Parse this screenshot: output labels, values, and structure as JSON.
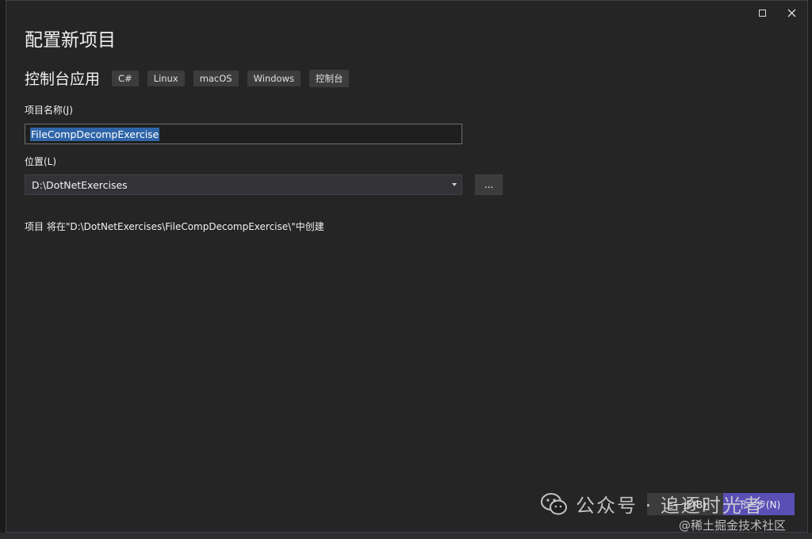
{
  "window": {
    "title": "配置新项目"
  },
  "template": {
    "name": "控制台应用",
    "tags": [
      "C#",
      "Linux",
      "macOS",
      "Windows",
      "控制台"
    ]
  },
  "project_name": {
    "label": "项目名称(J)",
    "value": "FileCompDecompExercise"
  },
  "location": {
    "label": "位置(L)",
    "value": "D:\\DotNetExercises",
    "browse_label": "..."
  },
  "info": {
    "text": "项目 将在\"D:\\DotNetExercises\\FileCompDecompExercise\\\"中创建"
  },
  "buttons": {
    "back": "上一步(B)",
    "next": "下一步(N)"
  },
  "watermark": {
    "main": "公众号 · 追逐时光者",
    "sub": "@稀土掘金技术社区"
  },
  "colors": {
    "dialog_bg": "#252526",
    "selection": "#2f65a8",
    "next_button": "#5a4fb5"
  }
}
